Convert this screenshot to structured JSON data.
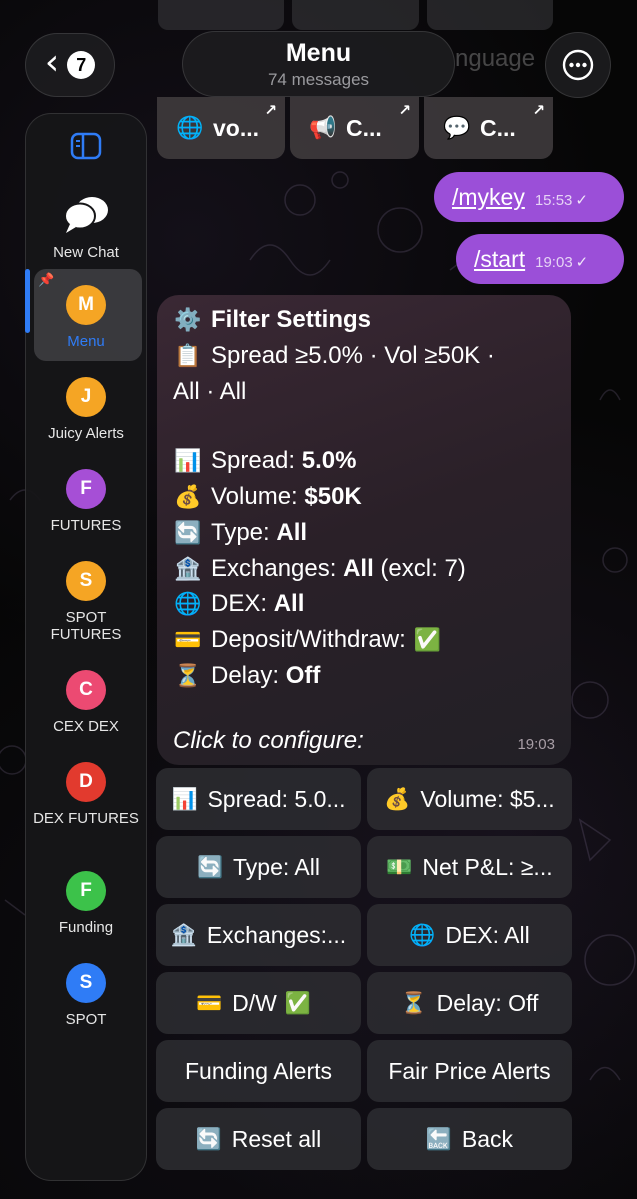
{
  "header": {
    "back_count": "7",
    "title": "Menu",
    "subtitle": "74 messages",
    "ghost_text": "nguage"
  },
  "sidebar": {
    "items": [
      {
        "label": "New Chat",
        "avatar": "",
        "color": "#ffffff"
      },
      {
        "label": "Menu",
        "avatar": "M",
        "color": "#f5a524"
      },
      {
        "label": "Juicy Alerts",
        "avatar": "J",
        "color": "#f5a524"
      },
      {
        "label": "FUTURES",
        "avatar": "F",
        "color": "#a64fd6"
      },
      {
        "label": "SPOT FUTURES",
        "avatar": "S",
        "color": "#f5a524"
      },
      {
        "label": "CEX DEX",
        "avatar": "C",
        "color": "#ec4a72"
      },
      {
        "label": "DEX FUTURES",
        "avatar": "D",
        "color": "#e23a2e"
      },
      {
        "label": "Funding",
        "avatar": "F",
        "color": "#3cc24a"
      },
      {
        "label": "SPOT",
        "avatar": "S",
        "color": "#2f7cf6"
      }
    ]
  },
  "top_keyboard": [
    {
      "icon": "globe-icon",
      "glyph": "🌐",
      "label": "vo..."
    },
    {
      "icon": "megaphone-icon",
      "glyph": "📢",
      "label": "C..."
    },
    {
      "icon": "speech-bubble-icon",
      "glyph": "💬",
      "label": "C..."
    }
  ],
  "outgoing": [
    {
      "command": "/mykey",
      "time": "15:53"
    },
    {
      "command": "/start",
      "time": "19:03"
    }
  ],
  "message": {
    "title": "Filter Settings",
    "summary_1": "Spread ≥5.0% · Vol ≥50K ·",
    "summary_2": "All · All",
    "spread_label": "Spread: ",
    "spread_value": "5.0%",
    "volume_label": "Volume: ",
    "volume_value": "$50K",
    "type_label": "Type: ",
    "type_value": "All",
    "exchanges_label": "Exchanges: ",
    "exchanges_value": "All",
    "exchanges_extra": " (excl: 7)",
    "dex_label": "DEX: ",
    "dex_value": "All",
    "dw_label": "Deposit/Withdraw: ",
    "delay_label": "Delay: ",
    "delay_value": "Off",
    "footer": "Click to configure:",
    "time": "19:03"
  },
  "keyboard": {
    "spread": "Spread: 5.0...",
    "volume": "Volume: $5...",
    "type": "Type: All",
    "net_pnl": "Net P&L: ≥...",
    "exchanges": "Exchanges:...",
    "dex": "DEX: All",
    "dw": "D/W",
    "delay": "Delay: Off",
    "funding_alerts": "Funding Alerts",
    "fair_price_alerts": "Fair Price Alerts",
    "reset_all": "Reset all",
    "back": "Back"
  },
  "colors": {
    "accent": "#2f7cf6",
    "outgoing_bubble": "#9b4fd8",
    "check_green": "#3cc24a"
  }
}
